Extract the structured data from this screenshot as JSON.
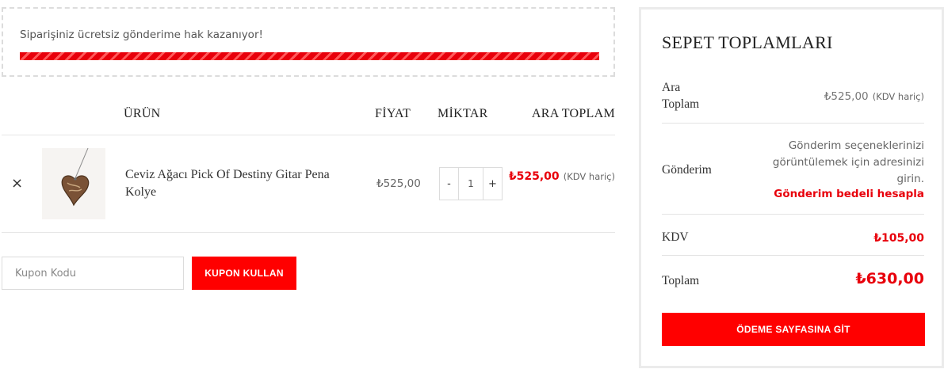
{
  "notice": {
    "text": "Siparişiniz ücretsiz gönderime hak kazanıyor!",
    "progress_percent": 100,
    "bar_color": "#e8000b"
  },
  "cart_table": {
    "headers": {
      "product": "ÜRÜN",
      "price": "FİYAT",
      "quantity": "MİKTAR",
      "subtotal": "ARA TOPLAM"
    },
    "items": [
      {
        "remove_icon": "close-icon",
        "remove_symbol": "×",
        "name": "Ceviz Ağacı Pick Of Destiny Gitar Pena Kolye",
        "price": "₺525,00",
        "quantity": "1",
        "qty_minus": "-",
        "qty_plus": "+",
        "line_total": "₺525,00",
        "line_total_note": "(KDV hariç)"
      }
    ]
  },
  "coupon": {
    "placeholder": "Kupon Kodu",
    "button_label": "KUPON KULLAN"
  },
  "totals": {
    "title": "SEPET TOPLAMLARI",
    "subtotal_label": "Ara Toplam",
    "subtotal_value": "₺525,00",
    "subtotal_note": "(KDV hariç)",
    "shipping_label": "Gönderim",
    "shipping_text": "Gönderim seçeneklerinizi görüntülemek için adresinizi girin.",
    "shipping_link": "Gönderim bedeli hesapla",
    "tax_label": "KDV",
    "tax_value": "₺105,00",
    "total_label": "Toplam",
    "total_value": "₺630,00",
    "checkout_label": "ÖDEME SAYFASINA GİT"
  },
  "colors": {
    "accent": "#ff0000",
    "price_red": "#e8000b"
  }
}
